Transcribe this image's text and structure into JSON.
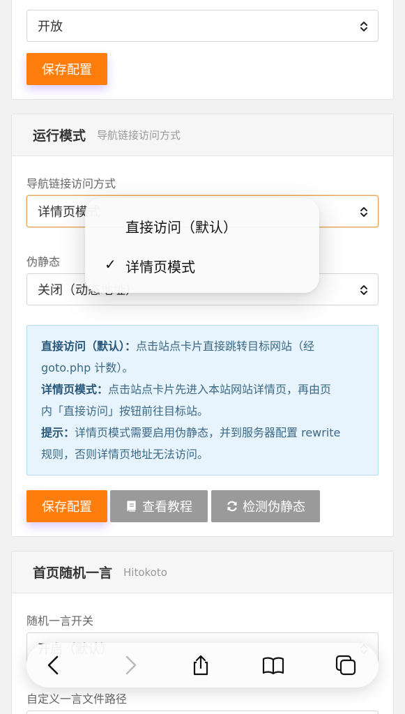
{
  "top_card": {
    "select_value": "开放",
    "save_label": "保存配置"
  },
  "run_mode": {
    "title": "运行模式",
    "subtitle": "导航链接访问方式",
    "access_label": "导航链接访问方式",
    "access_value": "详情页模式",
    "rewrite_label": "伪静态",
    "rewrite_value": "关闭（动态地址）",
    "info": {
      "l1_key": "直接访问（默认）：",
      "l1_text": "点击站点卡片直接跳转目标网站（经",
      "l2_text": "goto.php 计数）。",
      "l3_key": "详情页模式：",
      "l3_text": "点击站点卡片先进入本站网站详情页，再由页",
      "l4_text": "内「直接访问」按钮前往目标站。",
      "l5_key": "提示：",
      "l5_text": "详情页模式需要启用伪静态，并到服务器配置 rewrite",
      "l6_text": "规则，否则详情页地址无法访问。"
    },
    "save_label": "保存配置",
    "tutorial_label": "查看教程",
    "check_label": "检测伪静态"
  },
  "dropdown": {
    "options": [
      "直接访问（默认）",
      "详情页模式"
    ],
    "selected": "详情页模式"
  },
  "hitokoto": {
    "title": "首页随机一言",
    "subtitle": "Hitokoto",
    "switch_label": "随机一言开关",
    "switch_value": "开启（默认）",
    "path_label": "自定义一言文件路径"
  },
  "colors": {
    "accent": "#ff7d0d",
    "gray_button": "#9a9a9a",
    "info_bg": "#e8f4fd"
  }
}
